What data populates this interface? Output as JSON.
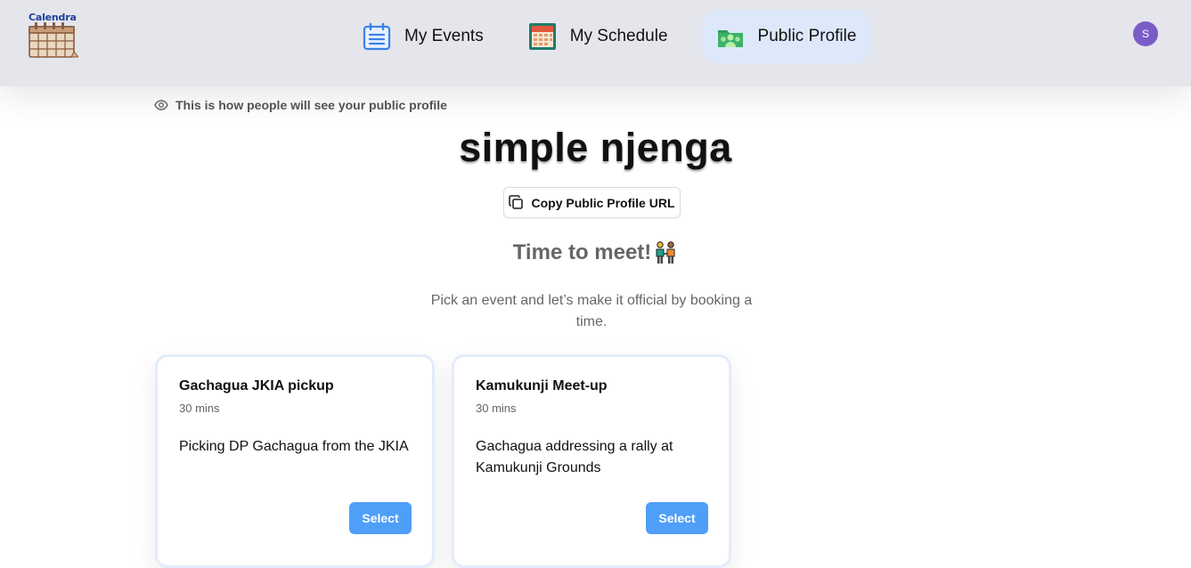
{
  "app": {
    "logo_text": "Calendra",
    "avatar_initial": "S"
  },
  "nav": {
    "items": [
      {
        "label": "My Events",
        "icon": "calendar-list-icon",
        "active": false
      },
      {
        "label": "My Schedule",
        "icon": "calendar-grid-icon",
        "active": false
      },
      {
        "label": "Public Profile",
        "icon": "people-folder-icon",
        "active": true
      }
    ]
  },
  "profile": {
    "notice": "This is how people will see your public profile",
    "name": "simple njenga",
    "copy_button": "Copy Public Profile URL",
    "meet_title": "Time to meet!",
    "subtitle": "Pick an event and let’s make it official by booking a time."
  },
  "events": [
    {
      "title": "Gachagua JKIA pickup",
      "duration": "30 mins",
      "description": "Picking DP Gachagua from the JKIA",
      "button": "Select"
    },
    {
      "title": "Kamukunji Meet-up",
      "duration": "30 mins",
      "description": "Gachagua addressing a rally at Kamukunji Grounds",
      "button": "Select"
    }
  ],
  "colors": {
    "header_bg": "#e4e6eb",
    "active_nav_bg": "#dde9fb",
    "accent": "#4f9ef8",
    "avatar": "#7b5cc7"
  }
}
